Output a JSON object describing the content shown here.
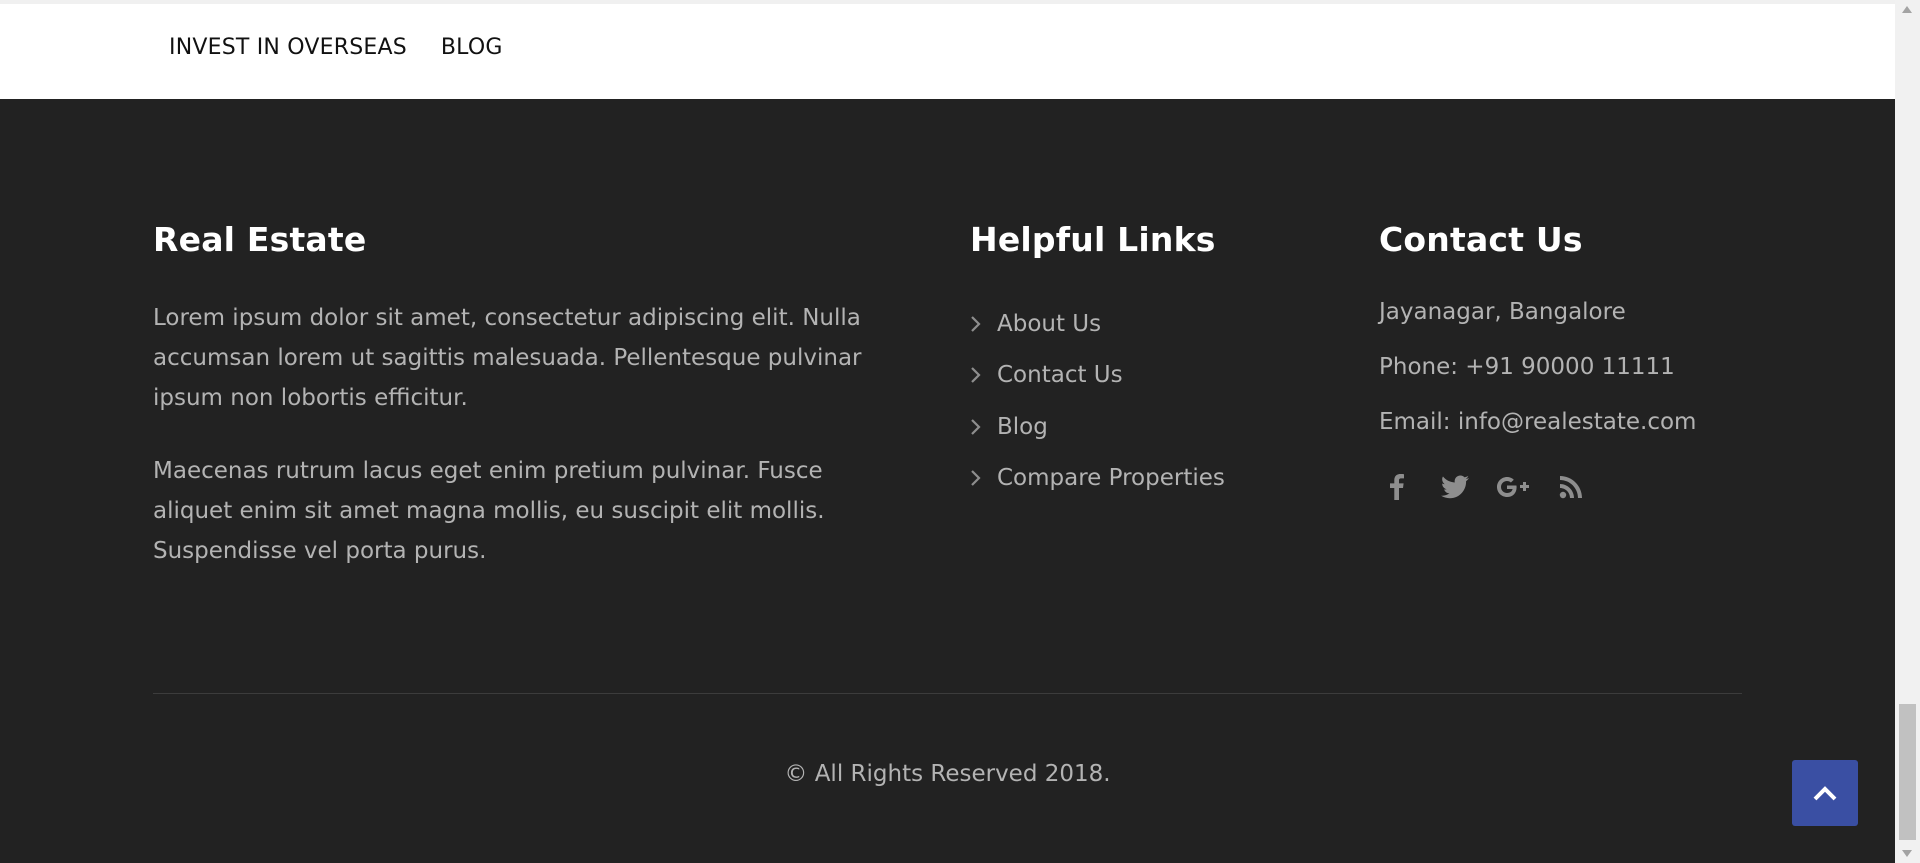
{
  "nav": {
    "items": [
      {
        "label": "INVEST IN OVERSEAS"
      },
      {
        "label": "BLOG"
      }
    ]
  },
  "footer": {
    "about": {
      "title": "Real Estate",
      "paragraphs": [
        "Lorem ipsum dolor sit amet, consectetur adipiscing elit. Nulla accumsan lorem ut sagittis malesuada. Pellentesque pulvinar ipsum non lobortis efficitur.",
        "Maecenas rutrum lacus eget enim pretium pulvinar. Fusce aliquet enim sit amet magna mollis, eu suscipit elit mollis. Suspendisse vel porta purus."
      ]
    },
    "links": {
      "title": "Helpful Links",
      "items": [
        {
          "label": "About Us"
        },
        {
          "label": "Contact Us"
        },
        {
          "label": "Blog"
        },
        {
          "label": "Compare Properties"
        }
      ]
    },
    "contact": {
      "title": "Contact Us",
      "address": "Jayanagar, Bangalore",
      "phone": "Phone: +91 90000 11111",
      "email": "Email: info@realestate.com",
      "social": [
        {
          "icon": "facebook-icon"
        },
        {
          "icon": "twitter-icon"
        },
        {
          "icon": "google-plus-icon"
        },
        {
          "icon": "rss-icon"
        }
      ]
    },
    "copyright": "©  All Rights Reserved 2018."
  },
  "colors": {
    "footer_bg": "#222222",
    "text_muted": "#b3b3b3",
    "heading": "#ffffff",
    "accent_button": "#3a4fa3"
  }
}
